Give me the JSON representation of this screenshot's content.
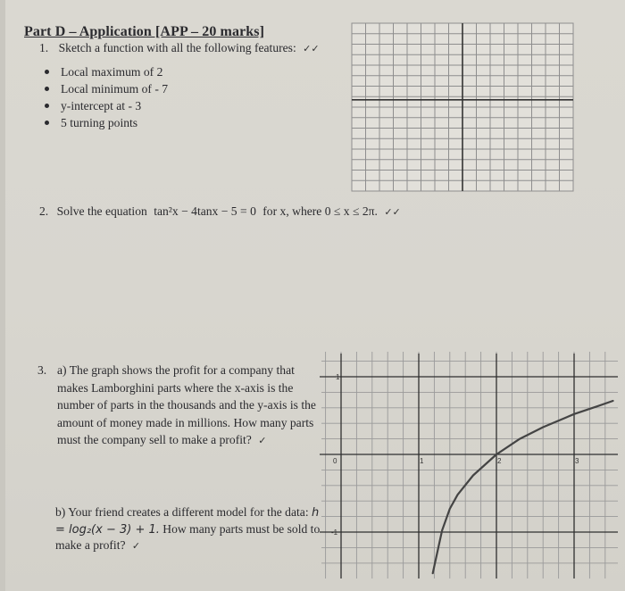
{
  "heading": "Part D – Application [APP – 20 marks]",
  "question1": {
    "number": "1.",
    "prompt": "Sketch a function with all the following features:",
    "marks": "✓✓",
    "features": [
      "Local maximum of 2",
      "Local minimum of - 7",
      "y-intercept at - 3",
      "5 turning points"
    ]
  },
  "question2": {
    "number": "2.",
    "prompt_before": "Solve the equation",
    "equation": "tan²x − 4tanx − 5 = 0",
    "prompt_after": "for x, where 0 ≤ x ≤ 2π.",
    "marks": "✓✓"
  },
  "question3": {
    "number": "3.",
    "part_a": "a) The graph shows the profit for a company that makes Lamborghini parts where the x-axis is the number of parts in the thousands and the y-axis is the amount of money made in millions. How many parts must the company sell to make a profit?",
    "part_a_marks": "✓",
    "part_b_prefix": "b) Your friend creates a different model for the data:",
    "part_b_equation": "h = log₂(x − 3) + 1.",
    "part_b_suffix": "How many parts must be sold to make a profit?",
    "part_b_marks": "✓"
  },
  "chart_data": [
    {
      "type": "grid",
      "title": "",
      "xlabel": "",
      "ylabel": "",
      "grid": true,
      "columns": 16,
      "rows": 16,
      "note": "blank coordinate grid for sketching, axes through center"
    },
    {
      "type": "line",
      "title": "",
      "xlabel": "",
      "ylabel": "",
      "grid": true,
      "minor_per_unit": 5,
      "xlim": [
        -0.3,
        3.5
      ],
      "ylim": [
        -1.55,
        1.3
      ],
      "x_ticks": [
        "0",
        "1",
        "2",
        "3"
      ],
      "y_ticks": [
        "1",
        "-1"
      ],
      "series": [
        {
          "name": "profit curve",
          "x": [
            1.18,
            1.22,
            1.3,
            1.4,
            1.5,
            1.7,
            2.0,
            2.3,
            2.6,
            3.0,
            3.3,
            3.5
          ],
          "y": [
            -1.53,
            -1.35,
            -0.98,
            -0.7,
            -0.52,
            -0.27,
            0.0,
            0.2,
            0.35,
            0.52,
            0.62,
            0.69
          ]
        }
      ]
    }
  ]
}
